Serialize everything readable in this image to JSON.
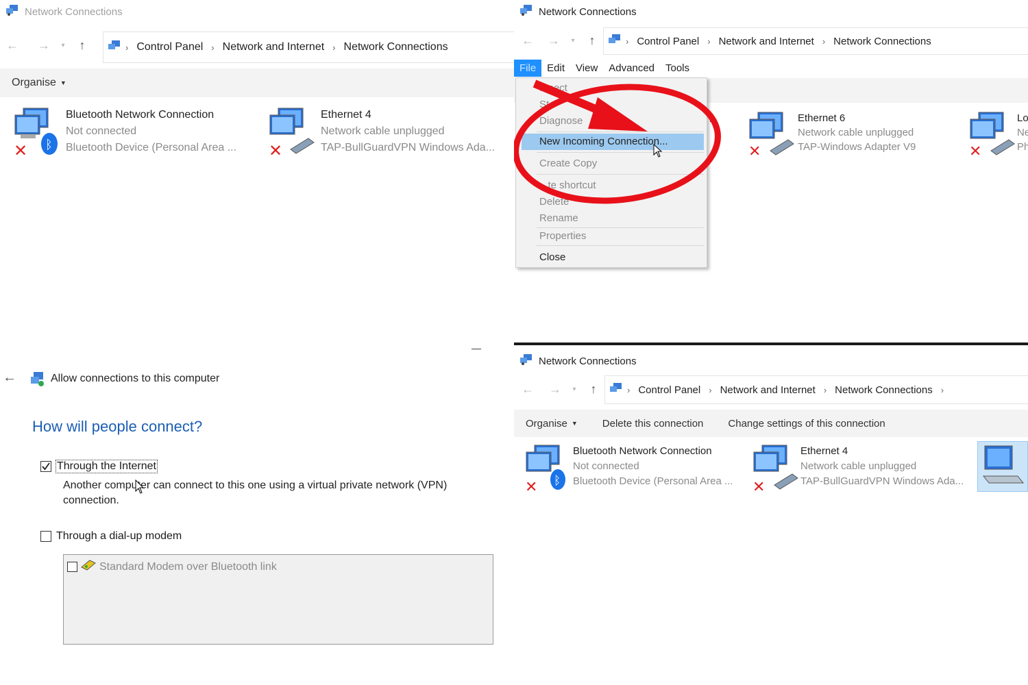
{
  "q1": {
    "title": "Network Connections",
    "breadcrumb": [
      "Control Panel",
      "Network and Internet",
      "Network Connections"
    ],
    "organise": "Organise",
    "connections": [
      {
        "name": "Bluetooth Network Connection",
        "status": "Not connected",
        "device": "Bluetooth Device (Personal Area ..."
      },
      {
        "name": "Ethernet 4",
        "status": "Network cable unplugged",
        "device": "TAP-BullGuardVPN Windows Ada..."
      }
    ]
  },
  "q2": {
    "title": "Network Connections",
    "breadcrumb": [
      "Control Panel",
      "Network and Internet",
      "Network Connections"
    ],
    "menu": [
      "File",
      "Edit",
      "View",
      "Advanced",
      "Tools"
    ],
    "file_menu": {
      "connect": "...nect",
      "status": "St",
      "diagnose": "Diagnose",
      "new_incoming": "New Incoming Connection...",
      "create_copy": "Create Copy",
      "create_shortcut": "...te shortcut",
      "delete": "Delete",
      "rename": "Rename",
      "properties": "Properties",
      "close": "Close"
    },
    "connections": [
      {
        "name": "Ethernet 6",
        "status": "Network cable unplugged",
        "device": "TAP-Windows Adapter V9"
      },
      {
        "name": "Loc",
        "status": "Ne",
        "device": "Pha"
      }
    ],
    "annotation_color": "#e8111a"
  },
  "q3": {
    "title": "Allow connections to this computer",
    "heading": "How will people connect?",
    "option_internet": {
      "label": "Through the Internet",
      "checked": true,
      "description": "Another computer can connect to this one using a virtual private network (VPN) connection."
    },
    "option_modem": {
      "label": "Through a dial-up modem",
      "checked": false
    },
    "modem_item": "Standard Modem over Bluetooth link",
    "minimize": "—"
  },
  "q4": {
    "title": "Network Connections",
    "breadcrumb": [
      "Control Panel",
      "Network and Internet",
      "Network Connections"
    ],
    "commands": [
      "Organise",
      "Delete this connection",
      "Change settings of this connection"
    ],
    "connections": [
      {
        "name": "Bluetooth Network Connection",
        "status": "Not connected",
        "device": "Bluetooth Device (Personal Area ..."
      },
      {
        "name": "Ethernet 4",
        "status": "Network cable unplugged",
        "device": "TAP-BullGuardVPN Windows Ada..."
      }
    ]
  },
  "colors": {
    "link_blue": "#1b5fb3",
    "highlight": "#9cc9ef",
    "menu_active": "#1e90ff"
  }
}
